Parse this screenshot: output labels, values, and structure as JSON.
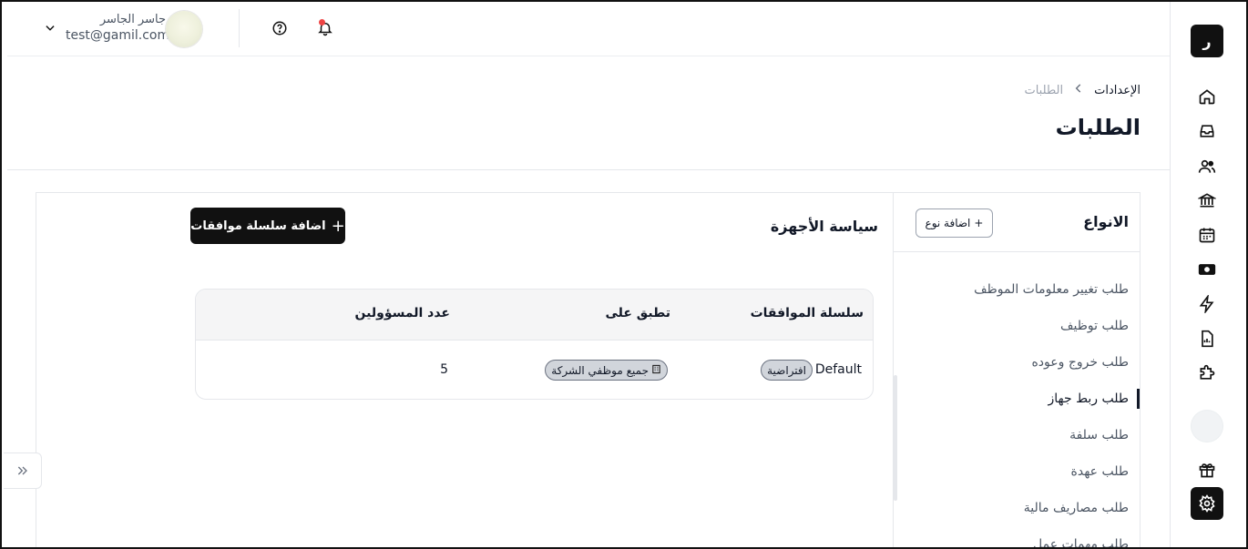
{
  "sidebar": {
    "logo_letter": "ﺭ",
    "items": [
      {
        "name": "home"
      },
      {
        "name": "inbox"
      },
      {
        "name": "employees"
      },
      {
        "name": "bank"
      },
      {
        "name": "calendar"
      },
      {
        "name": "cash"
      },
      {
        "name": "automation"
      },
      {
        "name": "reports"
      },
      {
        "name": "integrations"
      },
      {
        "name": "gift"
      },
      {
        "name": "settings"
      }
    ]
  },
  "header": {
    "user_name": "جاسر الجاسر",
    "user_email": "test@gamil.com"
  },
  "breadcrumb": {
    "root": "الإعدادات",
    "separator": "›",
    "current": "الطلبات"
  },
  "page": {
    "title": "الطلبات"
  },
  "types": {
    "title": "الانواع",
    "add_button": "اضافة نوع",
    "items": [
      "طلب تغيير معلومات الموظف",
      "طلب توظيف",
      "طلب خروج وعوده",
      "طلب ربط جهاز",
      "طلب سلفة",
      "طلب عهدة",
      "طلب مصاريف مالية",
      "طلب مهمات عمل"
    ],
    "active_index": 3
  },
  "policy": {
    "title": "سياسة الأجهزة",
    "add_chain_button": "اضافة سلسلة موافقات",
    "table": {
      "headers": [
        "سلسلة الموافقات",
        "تطبق على",
        "عدد المسؤولين"
      ],
      "rows": [
        {
          "chain_name": "Default",
          "chain_badge": "افتراضية",
          "applies_to": "جميع موظفي الشركة",
          "admins_count": "5"
        }
      ]
    }
  },
  "colors": {
    "accent": "#111111",
    "badge_bg": "#d1d5db",
    "notification_dot": "#ef4444"
  }
}
